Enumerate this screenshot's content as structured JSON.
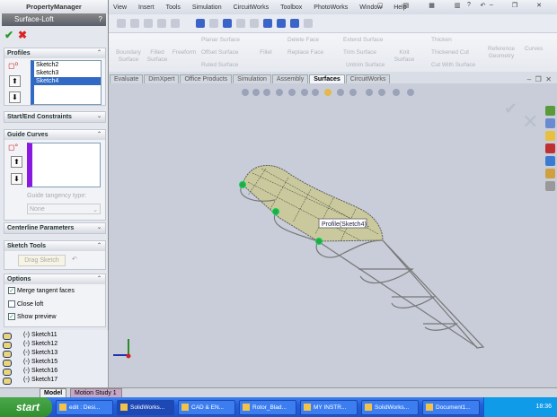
{
  "menu": [
    "View",
    "Insert",
    "Tools",
    "Simulation",
    "CircuitWorks",
    "Toolbox",
    "PhotoWorks",
    "Window",
    "Help"
  ],
  "commands": {
    "boundary": "Boundary Surface",
    "filled": "Filled Surface",
    "freeform": "Freeform",
    "planar": "Planar Surface",
    "offset": "Offset Surface",
    "ruled": "Ruled Surface",
    "fillet": "Fillet",
    "delete_face": "Delete Face",
    "replace_face": "Replace Face",
    "extend": "Extend Surface",
    "trim": "Trim Surface",
    "untrim": "Untrim Surface",
    "knit": "Knit Surface",
    "thicken": "Thicken",
    "thickened_cut": "Thickened Cut",
    "cut_with_surface": "Cut With Surface",
    "ref_geometry": "Reference Geometry",
    "curves": "Curves"
  },
  "tabs": [
    "Evaluate",
    "DimXpert",
    "Office Products",
    "Simulation",
    "Assembly",
    "Surfaces",
    "CircuitWorks"
  ],
  "active_tab": "Surfaces",
  "pm": {
    "title": "PropertyManager",
    "feature": "Surface-Loft",
    "help": "?",
    "profiles": {
      "header": "Profiles",
      "items": [
        "Sketch2",
        "Sketch3",
        "Sketch4"
      ],
      "selected": "Sketch4"
    },
    "start_end": "Start/End Constraints",
    "guide": {
      "header": "Guide Curves",
      "tangency_label": "Guide tangency type:",
      "tangency_value": "None"
    },
    "centerline": "Centerline Parameters",
    "sketch_tools": {
      "header": "Sketch Tools",
      "drag": "Drag Sketch"
    },
    "options": {
      "header": "Options",
      "items": [
        {
          "label": "Merge tangent faces",
          "checked": true
        },
        {
          "label": "Close loft",
          "checked": false
        },
        {
          "label": "Show preview",
          "checked": true
        }
      ]
    }
  },
  "tree": [
    "(-) Sketch11",
    "(-) Sketch12",
    "(-) Sketch13",
    "(-) Sketch15",
    "(-) Sketch16",
    "(-) Sketch17"
  ],
  "bottom_tabs": [
    "Model",
    "Motion Study 1"
  ],
  "viewport": {
    "callout": "Profile(Sketch4)"
  },
  "taskbar": {
    "start": "start",
    "items": [
      "edit : Desi...",
      "SolidWorks...",
      "CAD & EN...",
      "Rotor_Blad...",
      "MY INSTR...",
      "SolidWorks...",
      "Document1..."
    ],
    "active": 1,
    "clock": "18:36"
  }
}
